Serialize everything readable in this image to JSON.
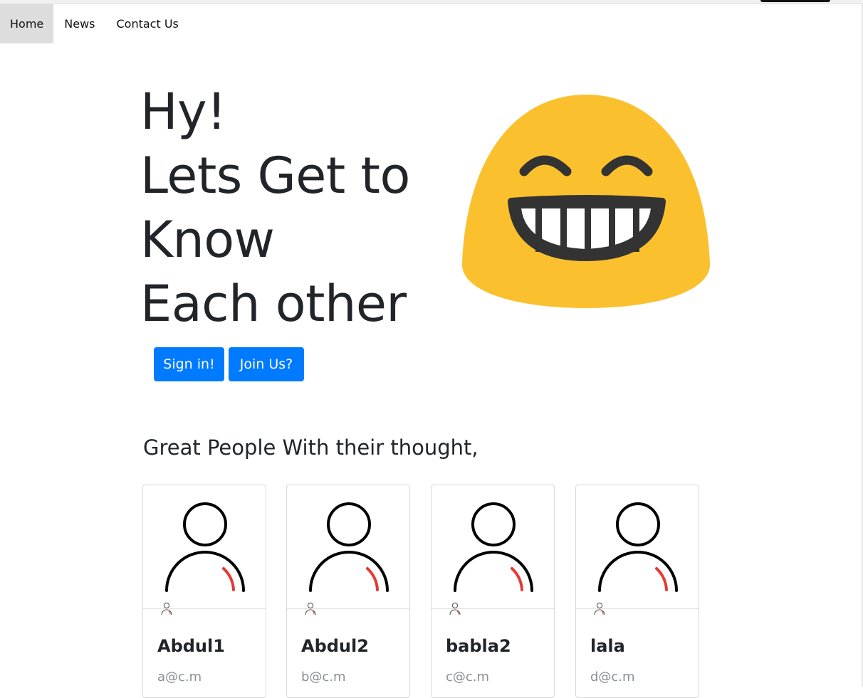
{
  "nav": {
    "items": [
      {
        "label": "Home",
        "active": true
      },
      {
        "label": "News",
        "active": false
      },
      {
        "label": "Contact Us",
        "active": false
      }
    ]
  },
  "hero": {
    "lines": [
      "Hy!",
      "Lets Get to",
      "Know",
      "Each other"
    ],
    "emoji_icon": "grinning-face-smiling-eyes-icon",
    "buttons": {
      "signin_label": "Sign in!",
      "join_label": "Join Us?"
    }
  },
  "section": {
    "heading": "Great People With their thought,"
  },
  "people": [
    {
      "name": "Abdul1",
      "email": "a@c.m"
    },
    {
      "name": "Abdul2",
      "email": "b@c.m"
    },
    {
      "name": "babla2",
      "email": "c@c.m"
    },
    {
      "name": "lala",
      "email": "d@c.m"
    }
  ],
  "colors": {
    "primary": "#007bff",
    "emoji_yellow": "#FBC02D",
    "emoji_dark": "#333333",
    "text": "#212529",
    "muted": "#8a8f96",
    "avatar_accent": "#e53935",
    "nav_active_bg": "#dddddd"
  }
}
